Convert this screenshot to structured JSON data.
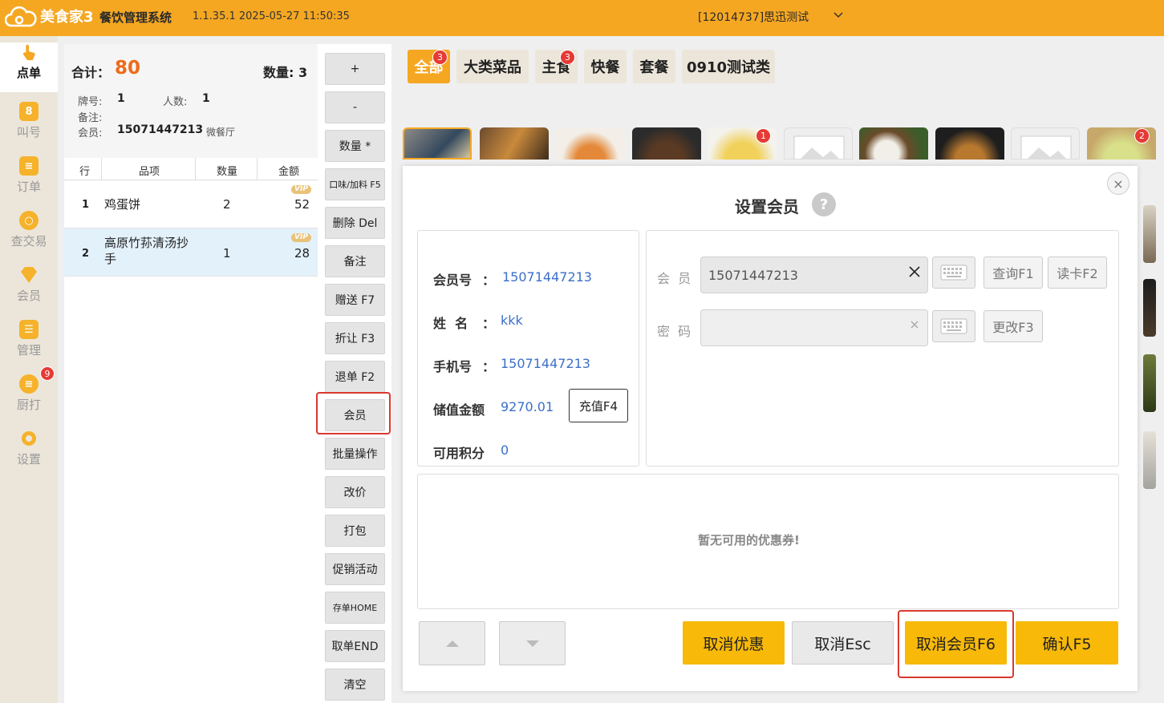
{
  "app": {
    "logo_text": "美食家3",
    "system_title": "餐饮管理系统",
    "version_time": "1.1.35.1 2025-05-27 11:50:35",
    "store_name": "[12014737]思迅测试"
  },
  "nav": {
    "items": [
      {
        "label": "点单",
        "icon": "hand-pointer-icon",
        "active": true
      },
      {
        "label": "叫号",
        "icon": "call-number-icon"
      },
      {
        "label": "订单",
        "icon": "order-list-icon"
      },
      {
        "label": "查交易",
        "icon": "search-transaction-icon"
      },
      {
        "label": "会员",
        "icon": "member-diamond-icon"
      },
      {
        "label": "管理",
        "icon": "manage-icon"
      },
      {
        "label": "厨打",
        "icon": "kitchen-print-icon",
        "badge": "9"
      },
      {
        "label": "设置",
        "icon": "settings-gear-icon"
      }
    ]
  },
  "order": {
    "total_label": "合计：",
    "total_value": "80",
    "qty_label": "数量:  3",
    "table_no_label": "牌号:",
    "table_no": "1",
    "people_label": "人数:",
    "people": "1",
    "note_label": "备注:",
    "member_label": "会员:",
    "member_no": "15071447213",
    "member_source": "微餐厅",
    "columns": [
      "行",
      "品项",
      "数量",
      "金额"
    ],
    "vip_tag": "VIP",
    "rows": [
      {
        "line": "1",
        "name": "鸡蛋饼",
        "qty": "2",
        "amount": "52"
      },
      {
        "line": "2",
        "name": "高原竹荪清汤抄手",
        "qty": "1",
        "amount": "28"
      }
    ]
  },
  "actions": {
    "buttons": [
      "+",
      "-",
      "数量 *",
      "口味/加料 F5",
      "删除 Del",
      "备注",
      "赠送 F7",
      "折让 F3",
      "退单 F2",
      "会员",
      "批量操作",
      "改价",
      "打包",
      "促销活动",
      "存单HOME",
      "取单END",
      "清空"
    ]
  },
  "categories": [
    {
      "label": "全部",
      "badge": "3",
      "active": true
    },
    {
      "label": "大类菜品"
    },
    {
      "label": "主食",
      "badge": "3"
    },
    {
      "label": "快餐"
    },
    {
      "label": "套餐"
    },
    {
      "label": "0910测试类"
    }
  ],
  "dish_badges": [
    "1",
    "2"
  ],
  "modal": {
    "title": "设置会员",
    "help": "?",
    "close": "×",
    "info": {
      "member_no_label": "会员号",
      "member_no": "15071447213",
      "name_label": "姓  名",
      "name": "kkk",
      "phone_label": "手机号",
      "phone": "15071447213",
      "balance_label": "储值金额",
      "balance": "9270.01",
      "recharge": "充值F4",
      "points_label": "可用积分",
      "points": "0",
      "colon": "："
    },
    "form": {
      "member_label": "会  员",
      "member_value": "15071447213",
      "password_label": "密  码",
      "password_value": "",
      "query_btn": "查询F1",
      "read_card_btn": "读卡F2",
      "change_btn": "更改F3"
    },
    "coupons_empty": "暂无可用的优惠券!",
    "footer": {
      "cancel_discount": "取消优惠",
      "cancel_esc": "取消Esc",
      "cancel_member": "取消会员F6",
      "confirm": "确认F5"
    }
  },
  "colors": {
    "brand": "#f5a722",
    "primary_button": "#f8b908",
    "highlight": "#d9382f",
    "link_value": "#3c6fc9"
  }
}
